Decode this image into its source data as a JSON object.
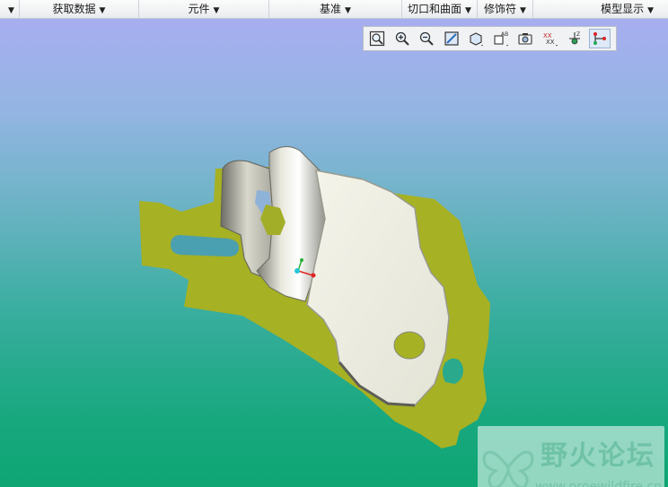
{
  "ribbon": {
    "groups": [
      {
        "label": "",
        "arrow": "▼"
      },
      {
        "label": "获取数据",
        "arrow": "▼"
      },
      {
        "label": "元件",
        "arrow": "▼"
      },
      {
        "label": "基准",
        "arrow": "▼"
      },
      {
        "label": "切口和曲面",
        "arrow": "▼"
      },
      {
        "label": "修饰符",
        "arrow": "▼"
      },
      {
        "label": "模型显示",
        "arrow": "▼"
      }
    ]
  },
  "view_toolbar": {
    "tools": [
      "zoom-fit-icon",
      "zoom-in-icon",
      "zoom-out-icon",
      "repaint-icon",
      "display-style-icon",
      "saved-views-icon",
      "view-manager-icon",
      "datum-display-icon",
      "spin-center-icon",
      "annotation-display-icon"
    ],
    "active": "annotation-display-icon"
  },
  "watermark": {
    "title": "野火论坛",
    "url": "www.proewildfire.cn"
  },
  "colors": {
    "flange": "#a6b124",
    "part_face": "#ececdf",
    "viewport_top": "#a7aef0",
    "viewport_bottom": "#0fa673"
  }
}
